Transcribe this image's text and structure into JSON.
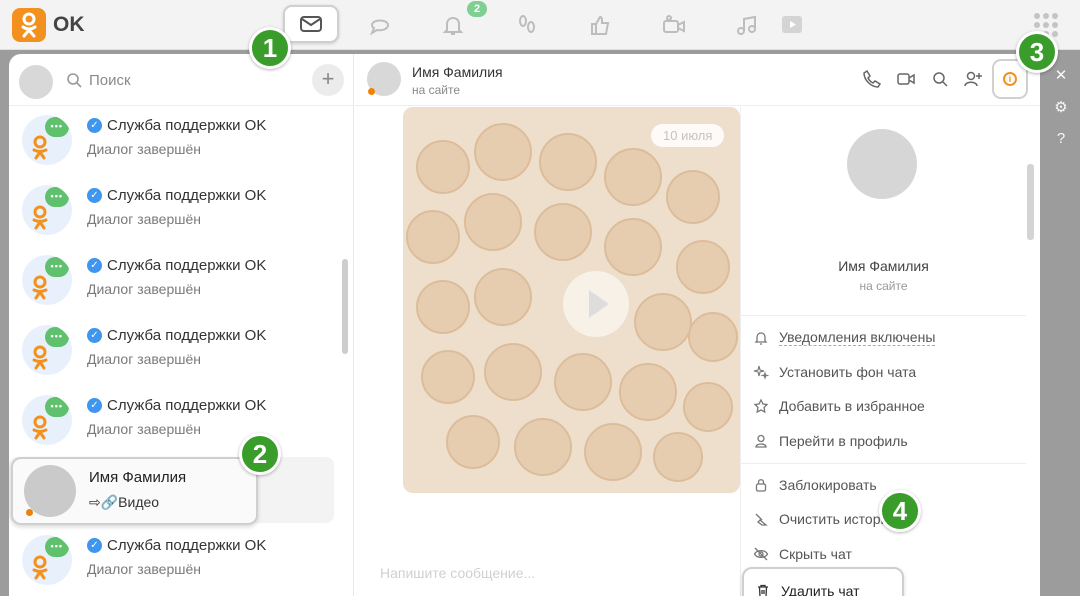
{
  "app": {
    "logo_text": "OK"
  },
  "top_nav": {
    "items": [
      {
        "name": "messages",
        "icon": "envelope-icon"
      },
      {
        "name": "discussions",
        "icon": "chat-bubbles-icon"
      },
      {
        "name": "notifications",
        "icon": "bell-icon",
        "badge": "2"
      },
      {
        "name": "guests",
        "icon": "footprints-icon"
      },
      {
        "name": "events",
        "icon": "thumbs-up-icon"
      },
      {
        "name": "video",
        "icon": "video-camera-icon"
      },
      {
        "name": "music",
        "icon": "music-note-icon"
      }
    ]
  },
  "sidebar": {
    "search_placeholder": "Поиск",
    "add_label": "+",
    "chats": [
      {
        "title": "Служба поддержки OK",
        "subtitle": "Диалог завершён",
        "verified": true
      },
      {
        "title": "Служба поддержки OK",
        "subtitle": "Диалог завершён",
        "verified": true
      },
      {
        "title": "Служба поддержки OK",
        "subtitle": "Диалог завершён",
        "verified": true
      },
      {
        "title": "Служба поддержки OK",
        "subtitle": "Диалог завершён",
        "verified": true
      },
      {
        "title": "Служба поддержки OK",
        "subtitle": "Диалог завершён",
        "verified": true
      },
      {
        "title": "Имя Фамилия",
        "subtitle": "⇨🔗Видео",
        "active": true
      },
      {
        "title": "Служба поддержки OK",
        "subtitle": "Диалог завершён",
        "verified": true
      }
    ]
  },
  "chat_header": {
    "name": "Имя Фамилия",
    "status": "на сайте"
  },
  "chat_body": {
    "date_pill": "10 июля",
    "composer_placeholder": "Напишите сообщение..."
  },
  "info_panel": {
    "name": "Имя Фамилия",
    "status": "на сайте",
    "menu": {
      "notifications": "Уведомления включены",
      "set_background": "Установить фон чата",
      "add_favorites": "Добавить в избранное",
      "go_profile": "Перейти в профиль",
      "block": "Заблокировать",
      "clear_history": "Очистить историю",
      "hide_chat": "Скрыть чат",
      "delete_chat": "Удалить чат"
    }
  },
  "steps": [
    "1",
    "2",
    "3",
    "4"
  ],
  "colors": {
    "brand_orange": "#f2911e",
    "step_green": "#3a9c2a",
    "badge_green": "#7fcf91",
    "verified_blue": "#3d96f0",
    "online_dot": "#ee8208"
  }
}
